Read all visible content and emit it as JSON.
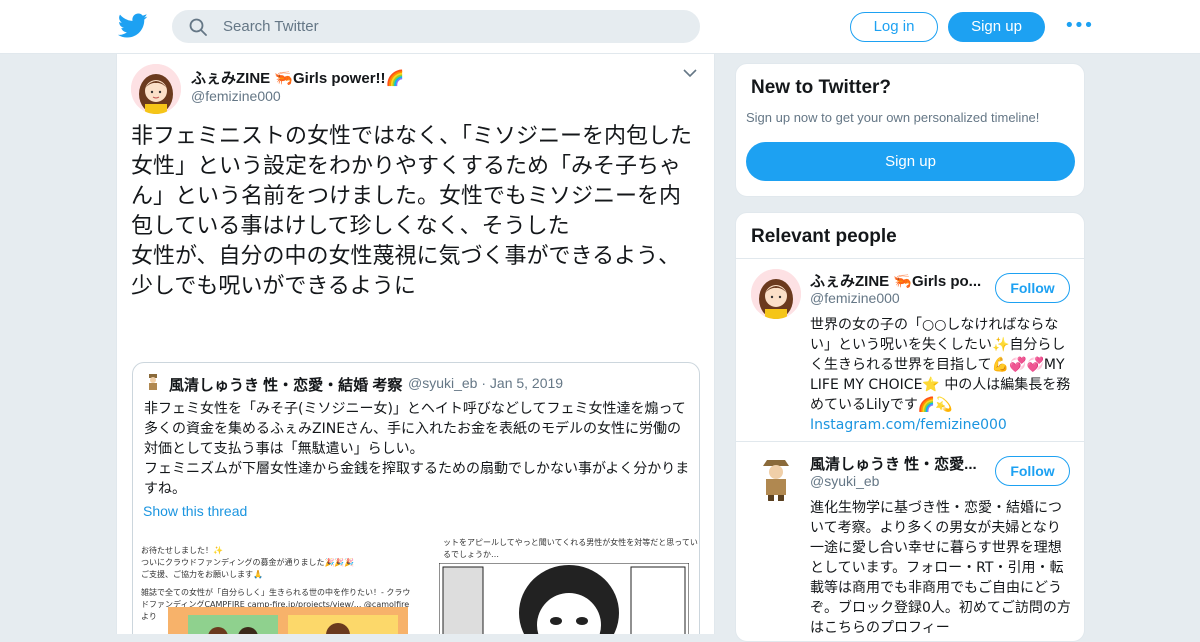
{
  "header": {
    "search_placeholder": "Search Twitter",
    "login_label": "Log in",
    "signup_label": "Sign up",
    "more_glyph": "•••"
  },
  "tweet": {
    "author_name": "ふぇみZINE 🦐Girls power!!🌈",
    "author_handle": "@femizine000",
    "text": "非フェミニストの女性ではなく、「ミソジニーを内包した女性」という設定をわかりやすくするため「みそ子ちゃん」という名前をつけました。女性でもミソジニーを内包している事はけして珍しくなく、そうした\n女性が、自分の中の女性蔑視に気づく事ができるよう、少しでも呪いができるように",
    "quoted": {
      "author_name": "風清しゅうき 性・恋愛・結婚 考察",
      "handle_date": "@syuki_eb · Jan 5, 2019",
      "text": "非フェミ女性を「みそ子(ミソジニー女)」とヘイト呼びなどしてフェミ女性達を煽って多くの資金を集めるふぇみZINEさん、手に入れたお金を表紙のモデルの女性に労働の対価として支払う事は「無駄遣い」らしい。\nフェミニズムが下層女性達から金銭を搾取するための扇動でしかない事がよく分かりますね。",
      "show_thread": "Show this thread",
      "image1_lines": [
        "お待たせしました！✨",
        "ついにクラウドファンディングの募金が通りました🎉🎉🎉",
        "ご支援、ご協力をお願いします🙏",
        "雑誌で全ての女性が「自分らしく」生きられる世の中を作りたい！- クラウドファンディングCAMPFIRE camp-fire.jp/projects/view/... @camolfireより"
      ],
      "image2_lines": [
        "ットをアピールしてやっと聞いてくれる男性が女性を対等だと思っているでしょうか…"
      ]
    }
  },
  "sidebar": {
    "new_title": "New to Twitter?",
    "new_sub": "Sign up now to get your own personalized timeline!",
    "new_signup": "Sign up",
    "relevant_title": "Relevant people",
    "people": [
      {
        "name": "ふぇみZINE 🦐Girls po...",
        "handle": "@femizine000",
        "follow": "Follow",
        "bio": "世界の女の子の「○○しなければならない」という呪いを失くしたい✨自分らしく生きられる世界を目指して💪💞💞MY LIFE MY CHOICE⭐ 中の人は編集長を務めているLilyです🌈💫",
        "link": "Instagram.com/femizine000"
      },
      {
        "name": "風清しゅうき 性・恋愛...",
        "handle": "@syuki_eb",
        "follow": "Follow",
        "bio": "進化生物学に基づき性・恋愛・結婚について考察。より多くの男女が夫婦となり一途に愛し合い幸せに暮らす世界を理想としています。フォロー・RT・引用・転載等は商用でも非商用でもご自由にどうぞ。ブロック登録0人。初めてご訪問の方はこちらのプロフィー"
      }
    ]
  },
  "colors": {
    "accent": "#1da1f2",
    "link": "#1b95e0",
    "secondary_text": "#657786",
    "background": "#e6ecf0"
  }
}
